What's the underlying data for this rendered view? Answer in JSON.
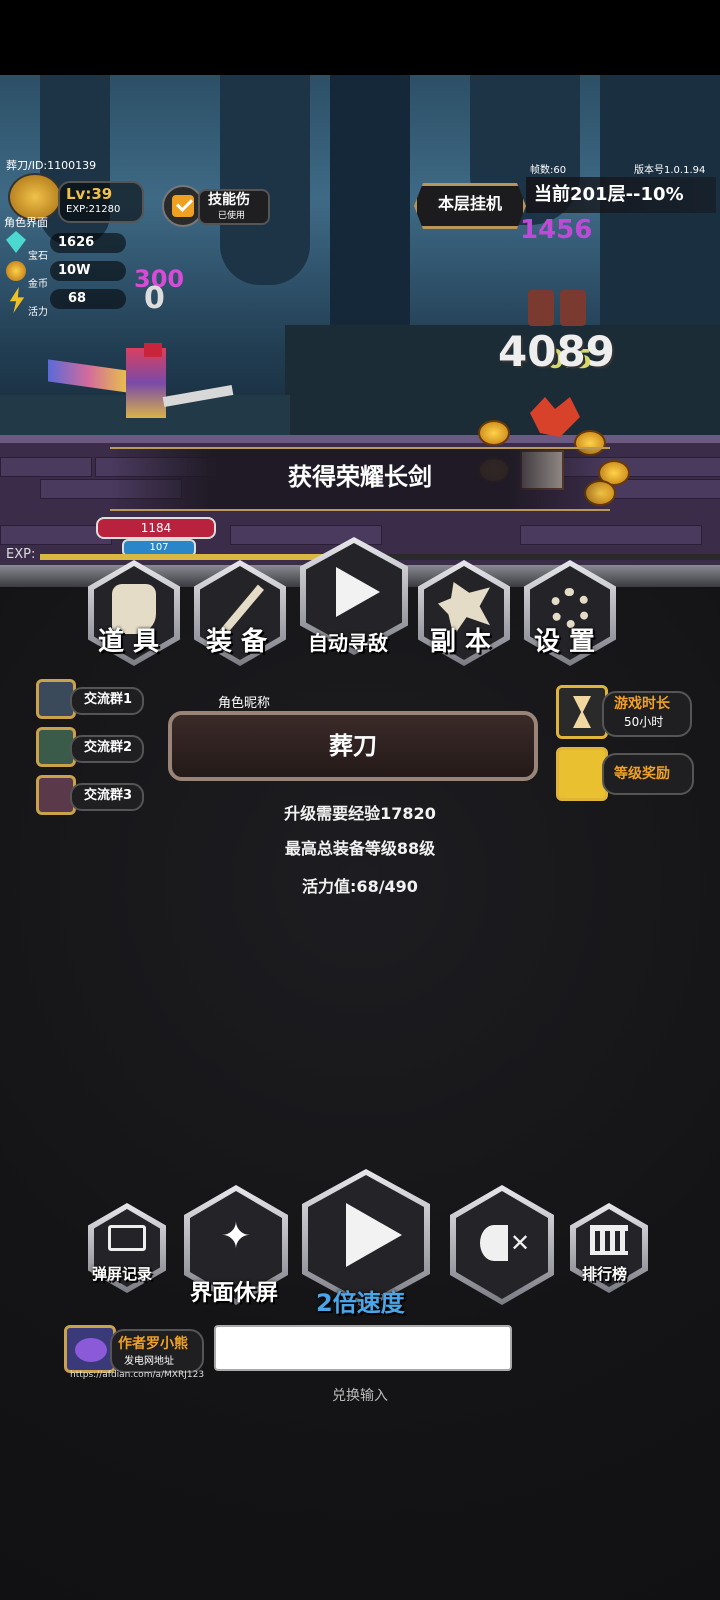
{
  "player": {
    "id_label": "葬刀/ID:1100139",
    "role_label": "角色界面",
    "level": "Lv:39",
    "exp": "EXP:21280"
  },
  "resources": [
    {
      "icon": "gem-icon",
      "label": "宝石",
      "value": "1626"
    },
    {
      "icon": "gold-coin-icon",
      "label": "金币",
      "value": "10W"
    },
    {
      "icon": "lightning-icon",
      "label": "活力",
      "value": "68"
    }
  ],
  "skill": {
    "label": "技能伤",
    "sub": "已使用"
  },
  "floor_idle_label": "本层挂机",
  "frame_rate": "帧数:60",
  "version": "版本号1.0.1.94",
  "current_floor": "当前201层--10%",
  "damage_numbers": {
    "magenta_top": "1456",
    "magenta_left": "300",
    "white_left": "0",
    "big_white": "4089",
    "yellow_small": "0.5"
  },
  "loot_banner": "获得荣耀长剑",
  "player_hp": "1184",
  "player_mp": "107",
  "exp_bar_label": "EXP:",
  "exp_progress": 0.43,
  "menu": [
    {
      "label": "道 具",
      "icon": "scroll-icon"
    },
    {
      "label": "装 备",
      "icon": "sword-icon"
    },
    {
      "label": "自动寻敌",
      "icon": "play-icon"
    },
    {
      "label": "副 本",
      "icon": "dragon-icon"
    },
    {
      "label": "设 置",
      "icon": "gear-icon"
    }
  ],
  "groups": [
    "交流群1",
    "交流群2",
    "交流群3"
  ],
  "nickname": {
    "caption": "角色昵称",
    "name": "葬刀"
  },
  "play_time": {
    "label": "游戏时长",
    "value": "50小时"
  },
  "level_reward": "等级奖励",
  "stats": [
    "升级需要经验17820",
    "最高总装备等级88级",
    "活力值:68/490"
  ],
  "bottom_buttons": {
    "danmaku": "弹屏记录",
    "screensaver": "界面休屏",
    "speed": "2倍速度",
    "ranking": "排行榜"
  },
  "author": {
    "name": "作者罗小熊",
    "sub": "发电网地址",
    "url": "https://afdian.com/a/MXRJ123"
  },
  "redeem": {
    "placeholder": "",
    "label": "兑换输入"
  }
}
